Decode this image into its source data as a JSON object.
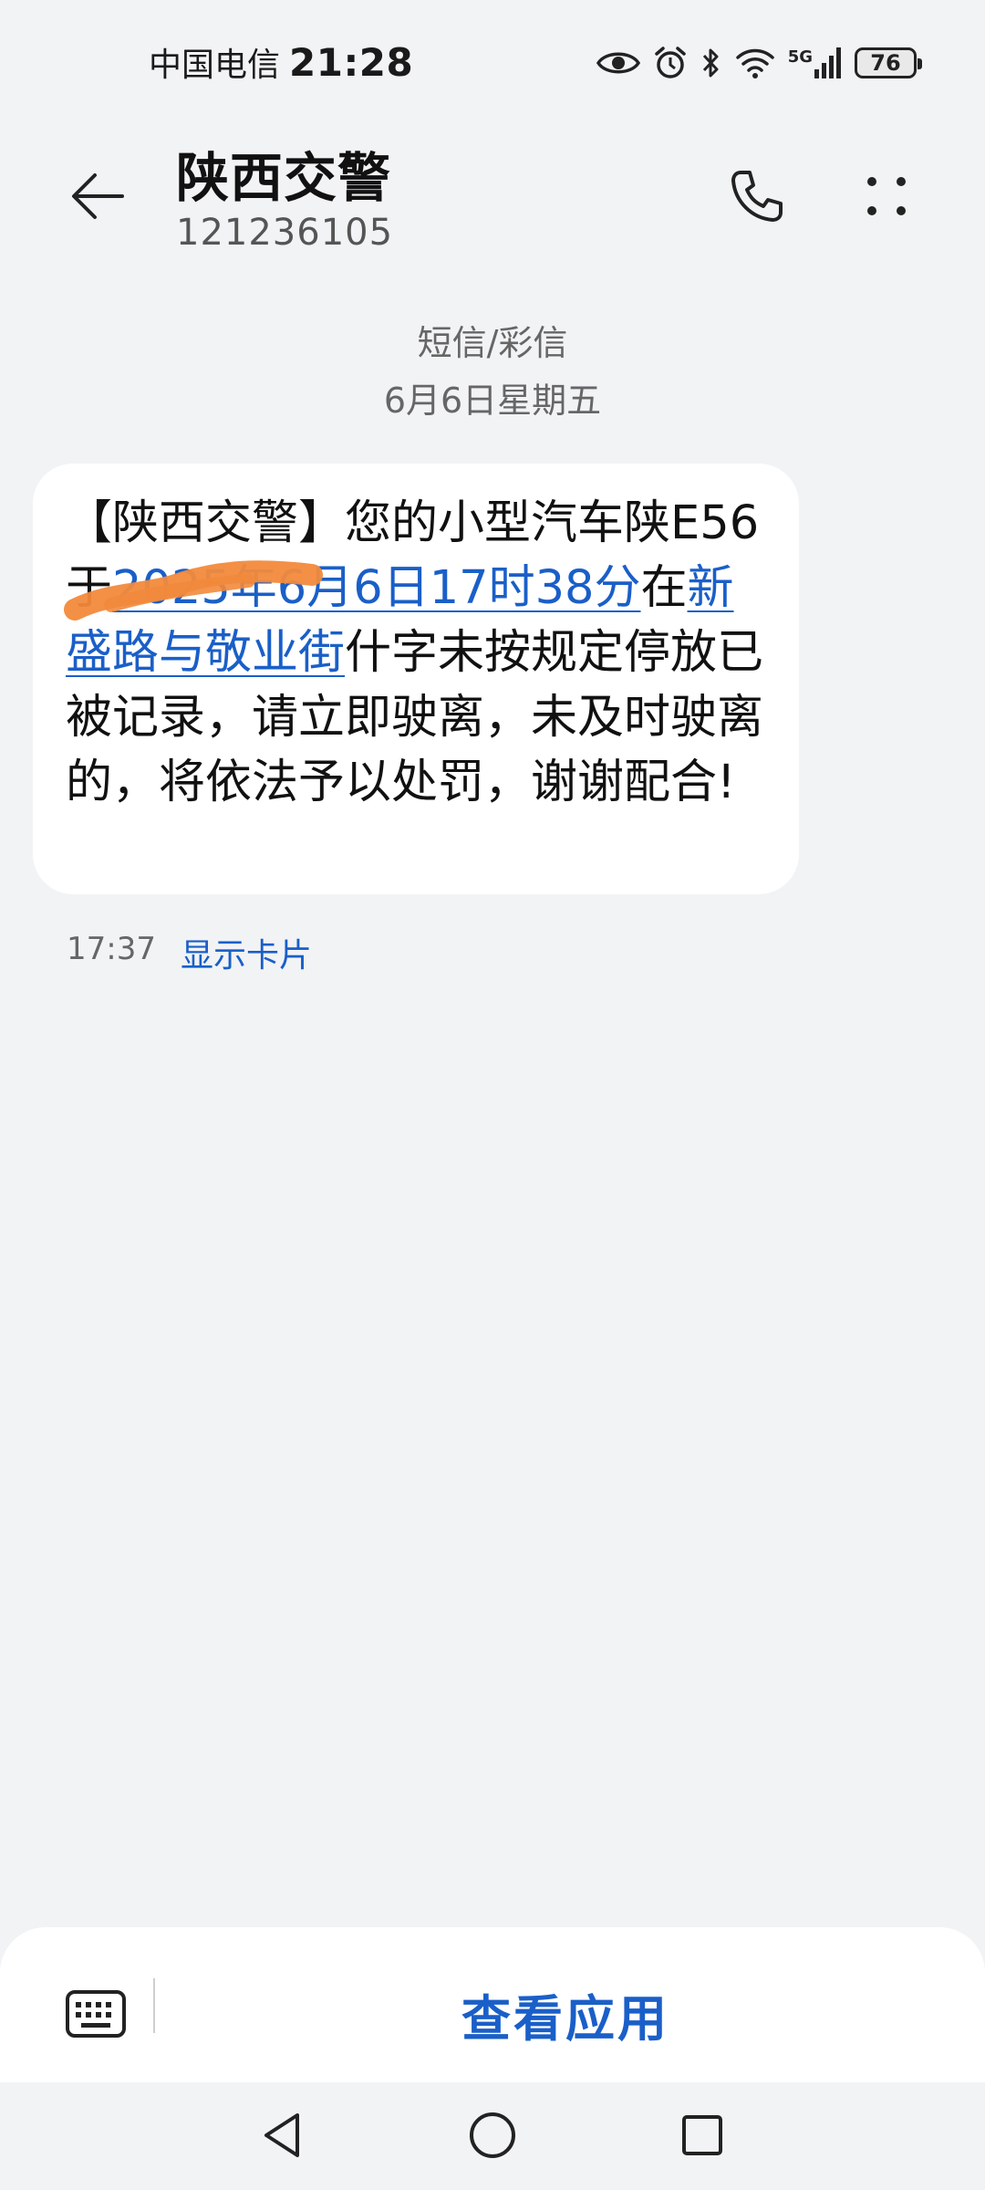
{
  "status_bar": {
    "carrier": "中国电信",
    "time": "21:28",
    "network": "5G",
    "battery": "76"
  },
  "header": {
    "contact_name": "陕西交警",
    "contact_number": "121236105"
  },
  "conversation": {
    "message_type": "短信/彩信",
    "date": "6月6日星期五"
  },
  "message": {
    "text_part1": "【陕西交警】您的小型汽车陕E5",
    "text_part2": "6",
    "text_part3": "于",
    "datetime_link": "2025年6月6日17时38分",
    "text_part4": "在",
    "location_link": "新盛路与敬业街",
    "text_part5": "什字未按规定停放已被记录，请立即驶离，未及时驶离的，将依法予以处罚，谢谢配合!",
    "time": "17:37",
    "show_card": "显示卡片"
  },
  "bottom_bar": {
    "view_app": "查看应用"
  },
  "icons": {
    "back": "back-arrow-icon",
    "call": "phone-icon",
    "more": "more-dots-icon",
    "keyboard": "keyboard-icon",
    "nav_back": "triangle-back-icon",
    "nav_home": "circle-home-icon",
    "nav_recents": "square-recents-icon"
  },
  "colors": {
    "link": "#1a5fc8",
    "background": "#f1f3f5",
    "bubble": "#ffffff",
    "redaction": "#f28a3c"
  }
}
